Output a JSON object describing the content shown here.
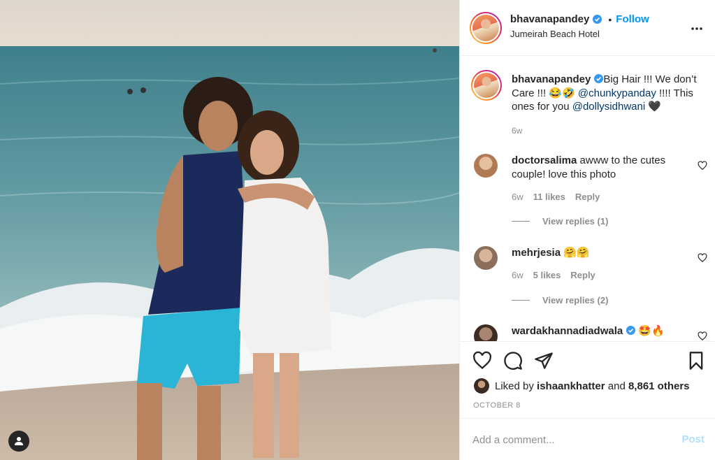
{
  "post": {
    "username": "bhavanapandey",
    "location": "Jumeirah Beach Hotel",
    "follow_label": "Follow",
    "dot": "•",
    "more_icon": "more-horizontal-icon",
    "photo_alt": "Couple standing on a beach shoreline"
  },
  "caption": {
    "username": "bhavanapandey",
    "text_part1": "Big Hair !!! We don’t Care !!! 😂🤣 ",
    "mention1": "@chunkypanday",
    "text_part2": " !!!! This ones for you ",
    "mention2": "@dollysidhwani",
    "text_part3": " 🖤",
    "time": "6w"
  },
  "comments": [
    {
      "username": "doctorsalima",
      "text": " awww to the cutes couple! love this photo",
      "time": "6w",
      "likes": "11 likes",
      "reply": "Reply",
      "view_replies": "View replies (1)",
      "avatar_color": "#d9b08c"
    },
    {
      "username": "mehrjesia",
      "text": " 🤗🤗",
      "time": "6w",
      "likes": "5 likes",
      "reply": "Reply",
      "view_replies": "View replies (2)",
      "avatar_color": "#b9a08a"
    },
    {
      "username": "wardakhannadiadwala",
      "text": " 🤩🔥",
      "avatar_color": "#5a4638"
    }
  ],
  "actions": {
    "liked_prefix": "Liked by ",
    "liked_user": "ishaankhatter",
    "liked_and": " and ",
    "liked_others": "8,861 others",
    "date": "OCTOBER 8"
  },
  "add_comment": {
    "placeholder": "Add a comment...",
    "post_label": "Post"
  },
  "colors": {
    "accent": "#0095f6",
    "mention": "#00376b",
    "muted": "#8e8e8e",
    "post_disabled": "#b2dffc"
  }
}
